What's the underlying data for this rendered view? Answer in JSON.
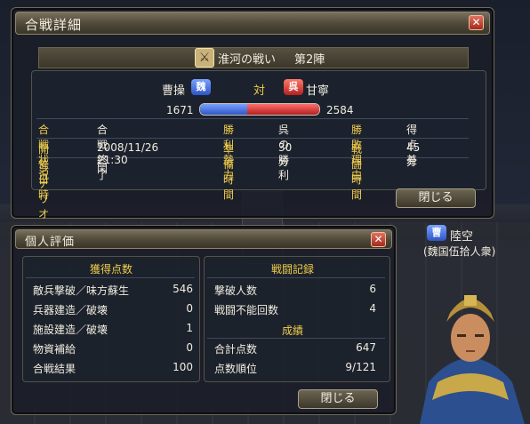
{
  "main_window": {
    "title": "合戦詳細",
    "close_label": "✕",
    "battle_name": "淮河の戦い",
    "battle_round": "第2陣",
    "left_side": {
      "name": "曹操",
      "kingdom": "魏",
      "score": "1671",
      "color": "#3a66d8"
    },
    "vs_label": "対",
    "right_side": {
      "name": "甘寧",
      "kingdom": "呉",
      "score": "2584",
      "color": "#c72a2a"
    },
    "power_ratio": 0.3928,
    "rows": [
      {
        "l1": "合戦状況",
        "v1": "合戦終了",
        "l2": "勝利勢力",
        "v2": "呉の勝利",
        "l3": "勝敗理由",
        "v3": "得点差"
      },
      {
        "l1": "開催日時",
        "v1": "2008/11/26 21:30",
        "l2": "準備時間",
        "v2": "30分",
        "l3": "戦闘時間",
        "v3": "45分"
      },
      {
        "l1": "シナリオ",
        "v1": "閑"
      }
    ],
    "close_button": "閉じる"
  },
  "personal_window": {
    "title": "個人評価",
    "close_label": "✕",
    "left_header": "獲得点数",
    "right_header": "戦闘記録",
    "result_header": "成績",
    "left_rows": [
      {
        "label": "敵兵撃破／味方蘇生",
        "value": "546"
      },
      {
        "label": "兵器建造／破壊",
        "value": "0"
      },
      {
        "label": "施設建造／破壊",
        "value": "1"
      },
      {
        "label": "物資補給",
        "value": "0"
      },
      {
        "label": "合戦結果",
        "value": "100"
      }
    ],
    "record_rows": [
      {
        "label": "撃破人数",
        "value": "6"
      },
      {
        "label": "戦闘不能回数",
        "value": "4"
      }
    ],
    "result_rows": [
      {
        "label": "合計点数",
        "value": "647"
      },
      {
        "label": "点数順位",
        "value": "9/121"
      }
    ],
    "close_button": "閉じる"
  },
  "character": {
    "kingdom": "曹",
    "name": "陸空",
    "unit": "(魏国伍拾人衆)"
  }
}
